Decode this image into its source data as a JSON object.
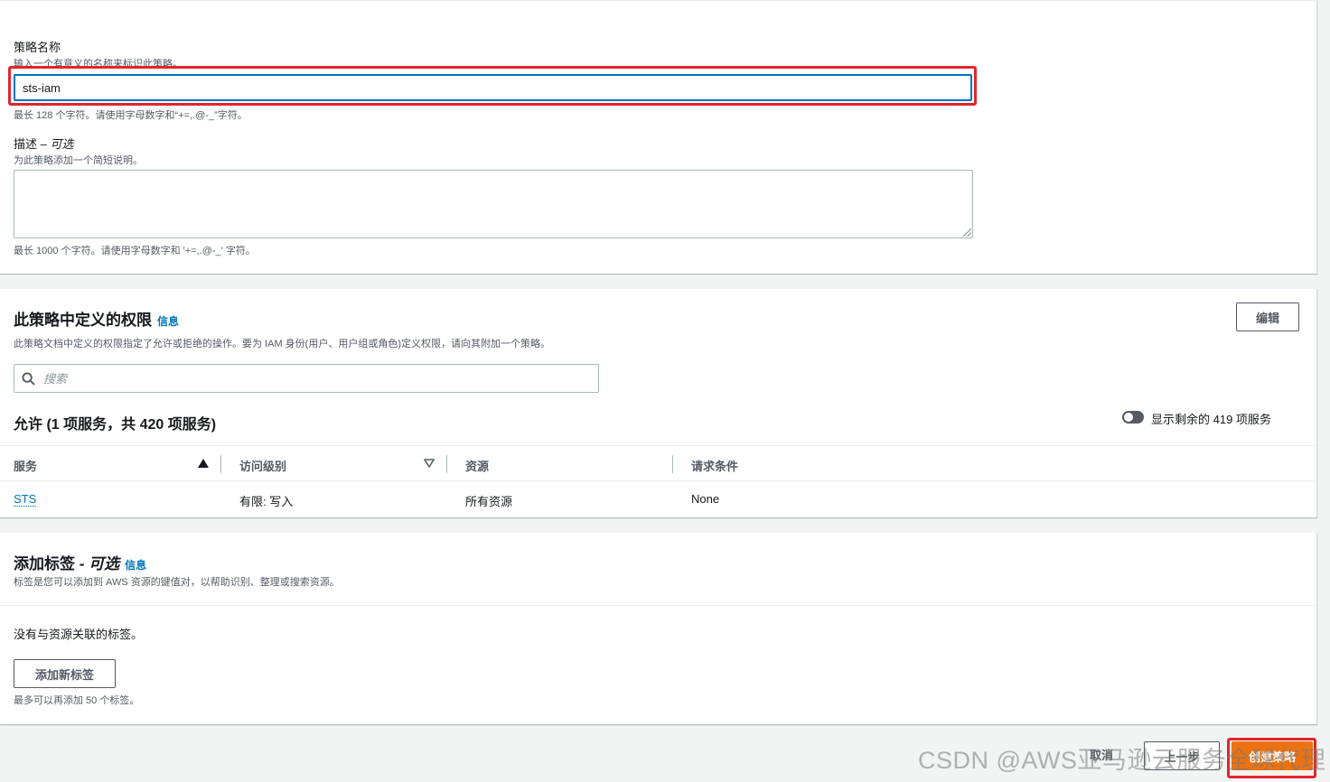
{
  "policy_details": {
    "name_label": "策略名称",
    "name_description": "输入一个有意义的名称来标识此策略。",
    "name_value": "sts-iam",
    "name_hint": "最长 128 个字符。请使用字母数字和“+=,.@-_”字符。",
    "desc_label": "描述 – ",
    "desc_optional": "可选",
    "desc_description": "为此策略添加一个简短说明。",
    "desc_value": "",
    "desc_hint": "最长 1000 个字符。请使用字母数字和 '+=,.@-_' 字符。"
  },
  "permissions": {
    "title": "此策略中定义的权限",
    "info": "信息",
    "edit_button": "编辑",
    "description": "此策略文档中定义的权限指定了允许或拒绝的操作。要为 IAM 身份(用户、用户组或角色)定义权限，请向其附加一个策略。",
    "search_placeholder": "搜索",
    "allow_heading": "允许 (1 项服务，共 420 项服务)",
    "toggle_label": "显示剩余的 419 项服务",
    "columns": [
      "服务",
      "访问级别",
      "资源",
      "请求条件"
    ],
    "rows": [
      {
        "service": "STS",
        "access_level": "有限: 写入",
        "resource": "所有资源",
        "condition": "None"
      }
    ]
  },
  "tags": {
    "title": "添加标签 - ",
    "title_optional": "可选",
    "info": "信息",
    "description": "标签是您可以添加到 AWS 资源的键值对，以帮助识别、整理或搜索资源。",
    "empty_text": "没有与资源关联的标签。",
    "add_button": "添加新标签",
    "limit_hint": "最多可以再添加 50 个标签。"
  },
  "footer": {
    "cancel": "取消",
    "previous": "上一步",
    "create": "创建策略"
  },
  "watermark": "CSDN @AWS亚马逊云服务全球代理",
  "colors": {
    "primary_button": "#ec7211",
    "link": "#0073bb",
    "highlight": "#e0262b"
  }
}
